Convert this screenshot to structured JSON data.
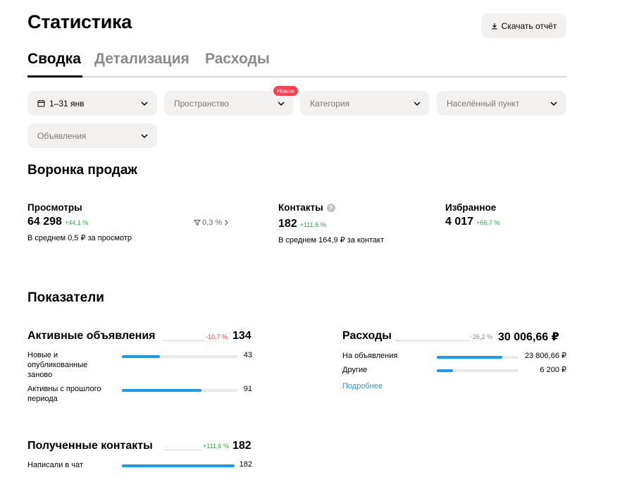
{
  "header": {
    "title": "Статистика",
    "download_label": "Скачать отчёт"
  },
  "tabs": [
    {
      "label": "Сводка",
      "active": true
    },
    {
      "label": "Детализация",
      "active": false
    },
    {
      "label": "Расходы",
      "active": false
    }
  ],
  "filters": {
    "period": "1–31 янв",
    "space": "Пространство",
    "space_badge": "Новое",
    "category": "Категория",
    "city": "Населённый пункт",
    "ads": "Объявления"
  },
  "funnel": {
    "title": "Воронка продаж",
    "views": {
      "name": "Просмотры",
      "value": "64 298",
      "delta": "+44,1 %",
      "note": "В среднем 0,5 ₽ за просмотр"
    },
    "conversion": "0,3 %",
    "contacts": {
      "name": "Контакты",
      "value": "182",
      "delta": "+111,6 %",
      "note": "В среднем 164,9 ₽ за контакт"
    },
    "favorites": {
      "name": "Избранное",
      "value": "4 017",
      "delta": "+66,7 %"
    }
  },
  "indicators": {
    "title": "Показатели",
    "active_ads": {
      "title": "Активные объявления",
      "delta": "-10,7 %",
      "value": "134",
      "rows": [
        {
          "label": "Новые и опубликованные заново",
          "value": "43",
          "fraction": 0.33
        },
        {
          "label": "Активны с прошлого периода",
          "value": "91",
          "fraction": 0.69
        }
      ]
    },
    "expenses": {
      "title": "Расходы",
      "delta": "-26,2 %",
      "value": "30 006,66 ₽",
      "rows": [
        {
          "label": "На объявления",
          "value": "23 806,66 ₽",
          "fraction": 0.8
        },
        {
          "label": "Другие",
          "value": "6 200 ₽",
          "fraction": 0.2
        }
      ],
      "more_link": "Подробнее"
    },
    "contacts": {
      "title": "Полученные контакты",
      "delta": "+111,6 %",
      "value": "182",
      "rows": [
        {
          "label": "Написали в чат",
          "value": "182",
          "fraction": 1.0
        }
      ]
    }
  },
  "colors": {
    "accent": "#1a9bf0",
    "positive": "#2fa54a",
    "negative": "#e0474c",
    "badge": "#ff4053"
  }
}
